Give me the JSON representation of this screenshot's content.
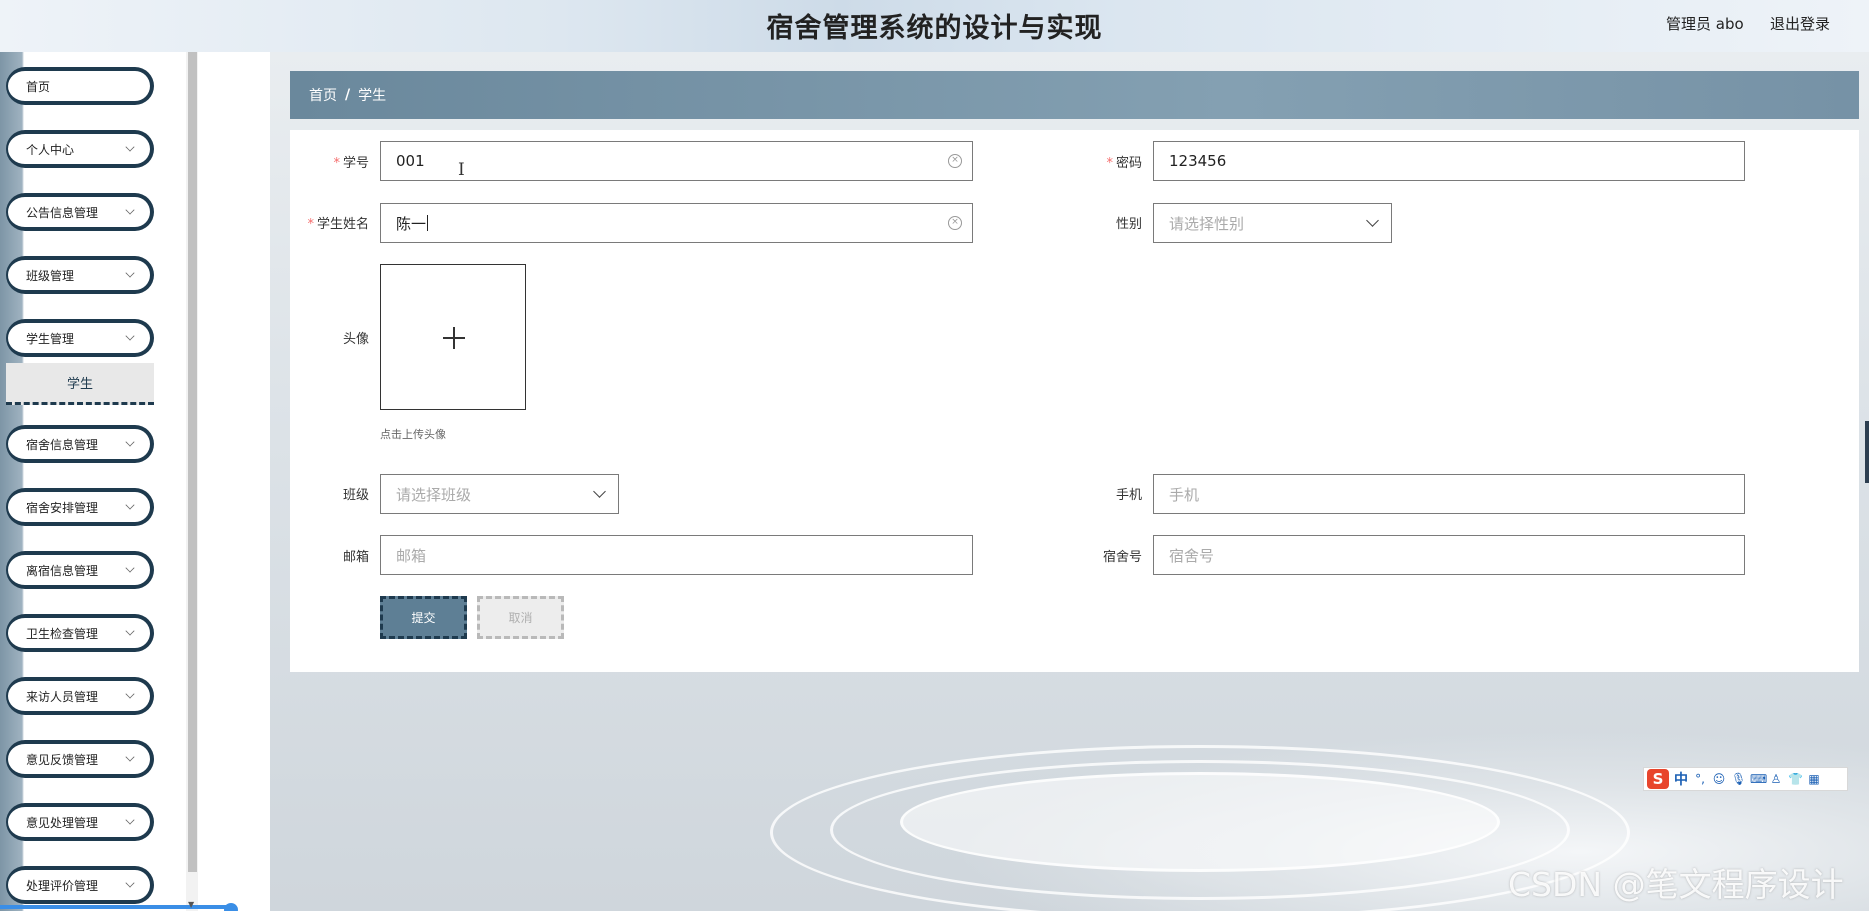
{
  "header": {
    "title": "宿舍管理系统的设计与实现",
    "user": "管理员 abo",
    "logout": "退出登录"
  },
  "sidebar": {
    "items": [
      {
        "label": "首页",
        "has_arrow": false
      },
      {
        "label": "个人中心",
        "has_arrow": true
      },
      {
        "label": "公告信息管理",
        "has_arrow": true
      },
      {
        "label": "班级管理",
        "has_arrow": true
      },
      {
        "label": "学生管理",
        "has_arrow": true
      },
      {
        "label": "宿舍信息管理",
        "has_arrow": true
      },
      {
        "label": "宿舍安排管理",
        "has_arrow": true
      },
      {
        "label": "离宿信息管理",
        "has_arrow": true
      },
      {
        "label": "卫生检查管理",
        "has_arrow": true
      },
      {
        "label": "来访人员管理",
        "has_arrow": true
      },
      {
        "label": "意见反馈管理",
        "has_arrow": true
      },
      {
        "label": "意见处理管理",
        "has_arrow": true
      },
      {
        "label": "处理评价管理",
        "has_arrow": true
      }
    ],
    "active_sub": "学生"
  },
  "breadcrumb": {
    "home": "首页",
    "separator": "/",
    "current": "学生"
  },
  "form": {
    "student_no": {
      "label": "学号",
      "value": "001",
      "required": true
    },
    "password": {
      "label": "密码",
      "value": "123456",
      "required": true
    },
    "student_name": {
      "label": "学生姓名",
      "value": "陈一",
      "required": true
    },
    "gender": {
      "label": "性别",
      "placeholder": "请选择性别"
    },
    "avatar": {
      "label": "头像",
      "tip": "点击上传头像"
    },
    "class": {
      "label": "班级",
      "placeholder": "请选择班级"
    },
    "phone": {
      "label": "手机",
      "placeholder": "手机"
    },
    "email": {
      "label": "邮箱",
      "placeholder": "邮箱"
    },
    "dorm_no": {
      "label": "宿舍号",
      "placeholder": "宿舍号"
    },
    "required_mark": "*",
    "submit": "提交",
    "cancel": "取消"
  },
  "ime": {
    "logo": "S",
    "mode": "中",
    "punct": "°,"
  },
  "watermark": "CSDN @笔文程序设计"
}
